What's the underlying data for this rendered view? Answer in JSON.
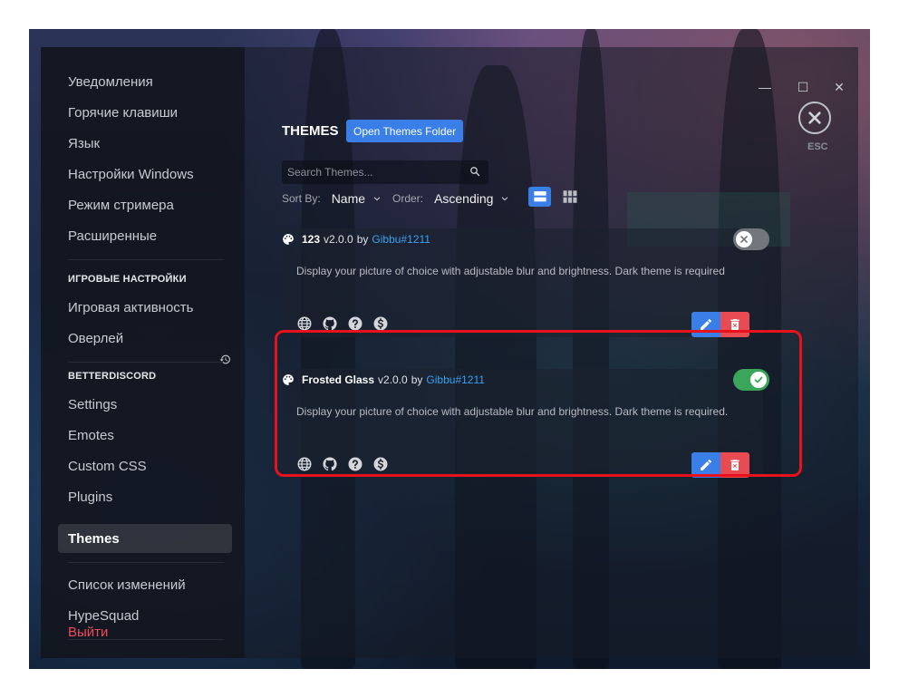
{
  "sidebar": {
    "items_top": [
      {
        "label": "Уведомления"
      },
      {
        "label": "Горячие клавиши"
      },
      {
        "label": "Язык"
      },
      {
        "label": "Настройки Windows"
      },
      {
        "label": "Режим стримера"
      },
      {
        "label": "Расширенные"
      }
    ],
    "gaming_header": "ИГРОВЫЕ НАСТРОЙКИ",
    "gaming_items": [
      {
        "label": "Игровая активность"
      },
      {
        "label": "Оверлей"
      }
    ],
    "bd_header": "BETTERDISCORD",
    "bd_items": [
      {
        "label": "Settings"
      },
      {
        "label": "Emotes"
      },
      {
        "label": "Custom CSS"
      },
      {
        "label": "Plugins"
      },
      {
        "label": "Themes"
      }
    ],
    "misc_items": [
      {
        "label": "Список изменений"
      },
      {
        "label": "HypeSquad"
      }
    ],
    "logout": "Выйти"
  },
  "window": {
    "minimize": "—",
    "maximize": "☐",
    "close": "✕",
    "esc_label": "ESC"
  },
  "header": {
    "title": "THEMES",
    "open_folder_label": "Open Themes Folder"
  },
  "search": {
    "placeholder": "Search Themes..."
  },
  "sort": {
    "sort_by_label": "Sort By:",
    "sort_by_value": "Name",
    "order_label": "Order:",
    "order_value": "Ascending",
    "view_mode": "list"
  },
  "themes": [
    {
      "name": "123",
      "version": "v2.0.0",
      "by": "by",
      "author": "Gibbu#1211",
      "description": "Display your picture of choice with adjustable blur and brightness. Dark theme is required",
      "enabled": false
    },
    {
      "name": "Frosted Glass",
      "version": "v2.0.0",
      "by": "by",
      "author": "Gibbu#1211",
      "description": "Display your picture of choice with adjustable blur and brightness. Dark theme is required.",
      "enabled": true
    }
  ],
  "colors": {
    "accent": "#3a7ee8",
    "danger": "#e94b52",
    "toggle_on": "#3ba55c",
    "toggle_off": "#72767d",
    "highlight": "#e8121c"
  }
}
